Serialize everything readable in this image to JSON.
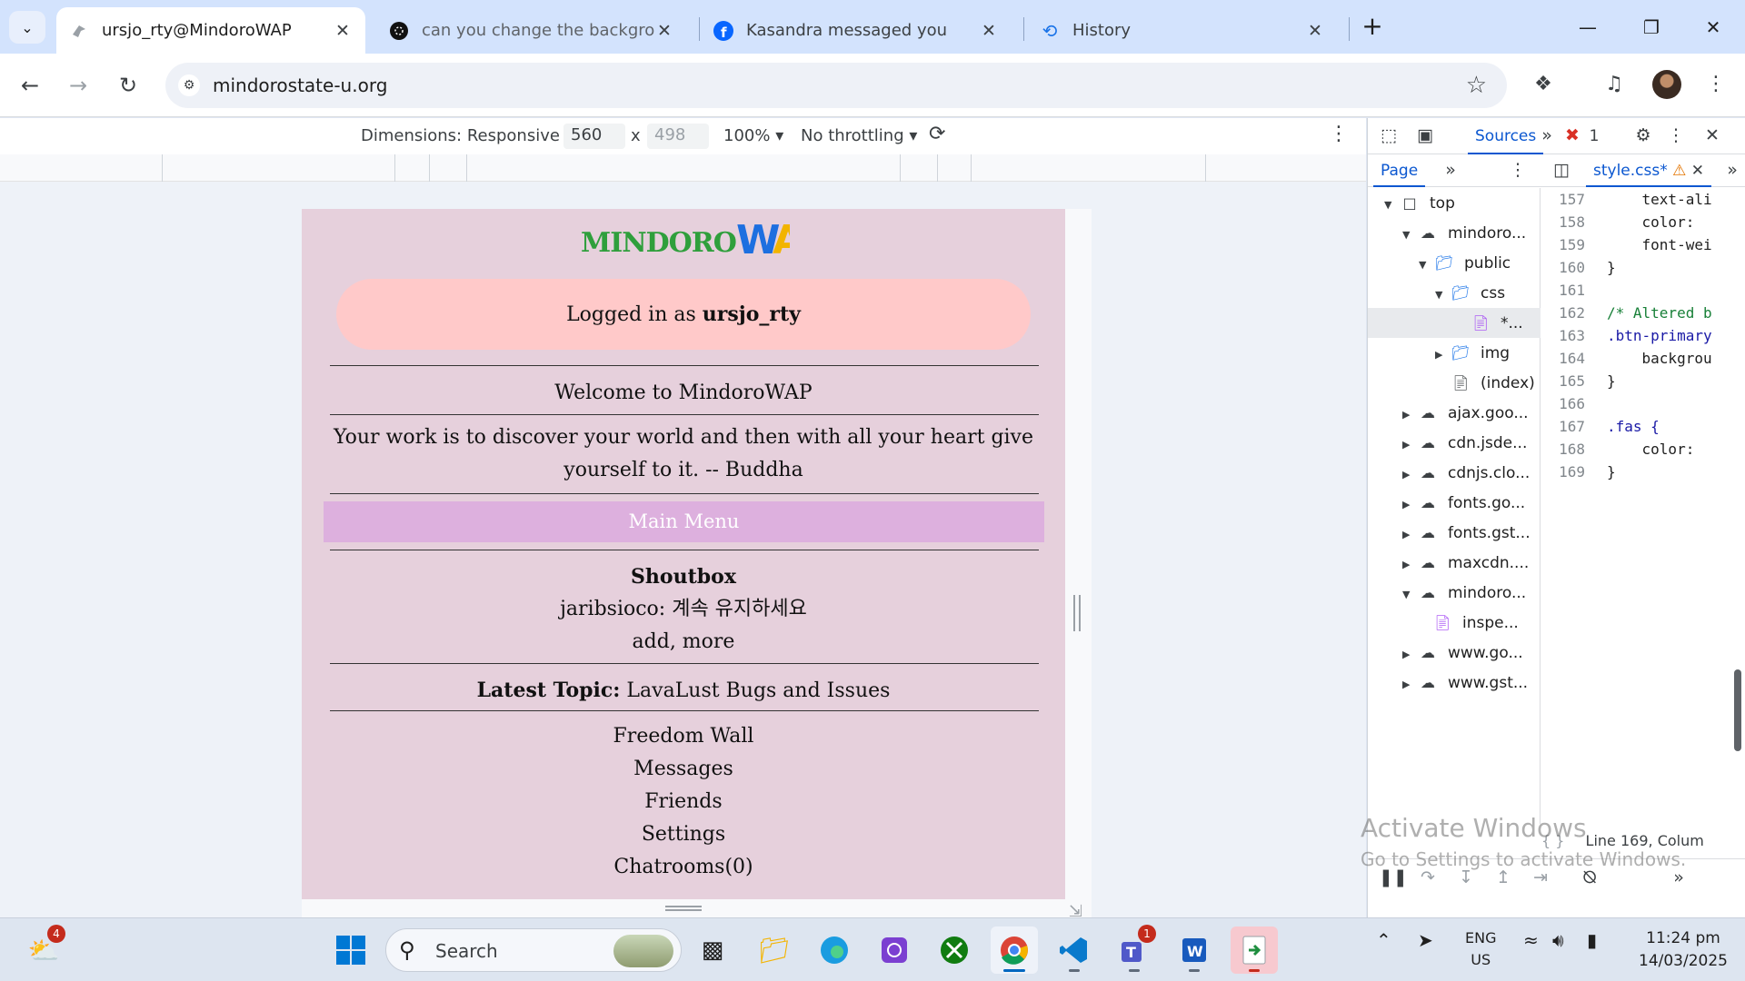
{
  "browser": {
    "tabs": [
      {
        "title": "ursjo_rty@MindoroWAP",
        "favicon": "wap-bird-icon",
        "active": true
      },
      {
        "title": "can you change the background",
        "favicon": "chatgpt-icon",
        "active": false
      },
      {
        "title": "Kasandra messaged you",
        "favicon": "facebook-icon",
        "active": false
      },
      {
        "title": "History",
        "favicon": "history-icon",
        "active": false
      }
    ],
    "url": "mindorostate-u.org"
  },
  "device_toolbar": {
    "dimensions_label": "Dimensions: Responsive",
    "width": "560",
    "times": "x",
    "height": "498",
    "zoom": "100%",
    "throttling": "No throttling"
  },
  "site": {
    "logo_part1": "MINDORO",
    "logo_part2": "WAP",
    "logged_in_prefix": "Logged in as ",
    "username": "ursjo_rty",
    "welcome": "Welcome to MindoroWAP",
    "quote": "Your work is to discover your world and then with all your heart give yourself to it. -- Buddha",
    "main_menu": "Main Menu",
    "shoutbox_title": "Shoutbox",
    "shout_line": "jaribsioco: 계속 유지하세요",
    "shout_more": "add, more",
    "latest_topic_label": "Latest Topic:",
    "latest_topic": " LavaLust Bugs and Issues",
    "menu_links": [
      "Freedom Wall",
      "Messages",
      "Friends",
      "Settings",
      "Chatrooms(0)"
    ]
  },
  "devtools": {
    "active_panel": "Sources",
    "error_count": "1",
    "navigator_tab": "Page",
    "file_tab": "style.css*",
    "tree": [
      {
        "label": "top",
        "icon": "frame-icon",
        "expanded": true
      },
      {
        "label": "mindoro...",
        "icon": "cloud-icon",
        "expanded": true
      },
      {
        "label": "public",
        "icon": "folder-icon",
        "expanded": true
      },
      {
        "label": "css",
        "icon": "folder-icon",
        "expanded": true
      },
      {
        "label": "*...",
        "icon": "file-icon",
        "selected": true
      },
      {
        "label": "img",
        "icon": "folder-icon",
        "expanded": false
      },
      {
        "label": "(index)",
        "icon": "file-icon"
      },
      {
        "label": "ajax.goo...",
        "icon": "cloud-icon"
      },
      {
        "label": "cdn.jsde...",
        "icon": "cloud-icon"
      },
      {
        "label": "cdnjs.clo...",
        "icon": "cloud-icon"
      },
      {
        "label": "fonts.go...",
        "icon": "cloud-icon"
      },
      {
        "label": "fonts.gst...",
        "icon": "cloud-icon"
      },
      {
        "label": "maxcdn....",
        "icon": "cloud-icon"
      },
      {
        "label": "mindoro...",
        "icon": "cloud-icon",
        "expanded": true
      },
      {
        "label": "inspe...",
        "icon": "file-icon"
      },
      {
        "label": "www.go...",
        "icon": "cloud-icon"
      },
      {
        "label": "www.gst...",
        "icon": "cloud-icon"
      }
    ],
    "code": [
      {
        "n": "157",
        "text": "    text-ali"
      },
      {
        "n": "158",
        "text": "    color: "
      },
      {
        "n": "159",
        "text": "    font-wei"
      },
      {
        "n": "160",
        "text": "}"
      },
      {
        "n": "161",
        "text": ""
      },
      {
        "n": "162",
        "text": "/* Altered b"
      },
      {
        "n": "163",
        "text": ".btn-primary"
      },
      {
        "n": "164",
        "text": "    backgrou"
      },
      {
        "n": "165",
        "text": "}"
      },
      {
        "n": "166",
        "text": ""
      },
      {
        "n": "167",
        "text": ".fas {"
      },
      {
        "n": "168",
        "text": "    color: "
      },
      {
        "n": "169",
        "text": "}"
      }
    ],
    "status": "Line 169, Colum"
  },
  "watermark": {
    "line1": "Activate Windows",
    "line2": "Go to Settings to activate Windows."
  },
  "taskbar": {
    "weather_badge": "4",
    "search_label": "Search",
    "teams_badge": "1",
    "lang": "ENG",
    "region": "US",
    "time": "11:24 pm",
    "date": "14/03/2025"
  }
}
